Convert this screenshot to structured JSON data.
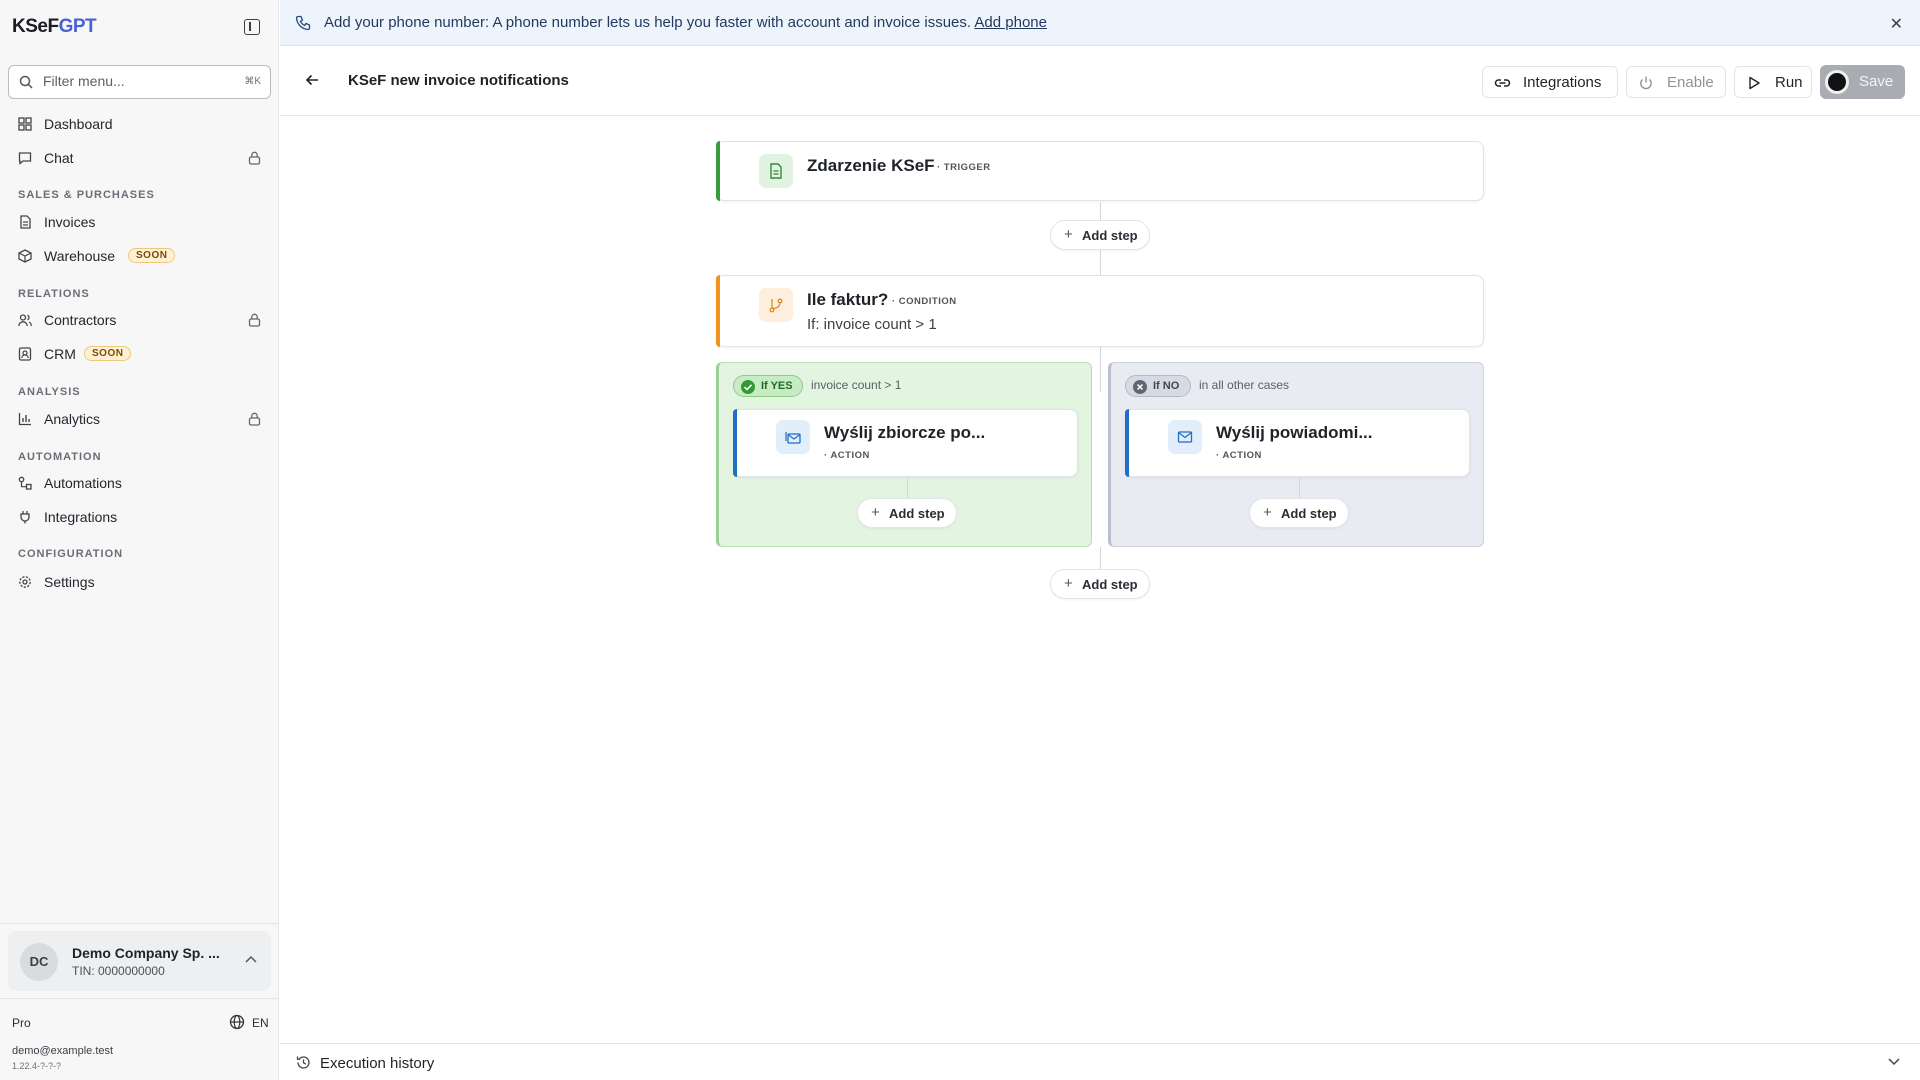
{
  "app": {
    "brand_main": "KSeF",
    "brand_accent": "GPT"
  },
  "sidebar": {
    "filter_placeholder": "Filter menu...",
    "filter_shortcut": "⌘K",
    "items": [
      {
        "label": "Dashboard"
      },
      {
        "label": "Chat"
      },
      {
        "label": "Invoices"
      },
      {
        "label": "Warehouse",
        "badge": "SOON"
      },
      {
        "label": "Contractors"
      },
      {
        "label": "CRM",
        "badge": "SOON"
      },
      {
        "label": "Analytics"
      },
      {
        "label": "Automations"
      },
      {
        "label": "Integrations"
      },
      {
        "label": "Settings"
      }
    ],
    "sections": [
      "SALES & PURCHASES",
      "RELATIONS",
      "ANALYSIS",
      "AUTOMATION",
      "CONFIGURATION"
    ],
    "company": {
      "initials": "DC",
      "name": "Demo Company Sp. ...",
      "tin": "TIN: 0000000000"
    },
    "plan": "Pro",
    "language": "EN",
    "email": "demo@example.test",
    "version": "1.22.4-?-?-?"
  },
  "banner": {
    "message": "Add your phone number: A phone number lets us help you faster with account and invoice issues.",
    "link": "Add phone"
  },
  "topbar": {
    "title": "KSeF new invoice notifications",
    "integrations_label": "Integrations",
    "enable_label": "Enable",
    "run_label": "Run",
    "save_label": "Save"
  },
  "flow": {
    "trigger": {
      "title": "Zdarzenie KSeF",
      "tag": "· TRIGGER"
    },
    "condition": {
      "title": "Ile faktur?",
      "tag": "· CONDITION",
      "subtitle": "If: invoice count > 1"
    },
    "yes_branch": {
      "pill": "If YES",
      "condition": "invoice count > 1",
      "action_title": "Wyślij zbiorcze po...",
      "action_tag": "· ACTION"
    },
    "no_branch": {
      "pill": "If NO",
      "condition": "in all other cases",
      "action_title": "Wyślij powiadomi...",
      "action_tag": "· ACTION"
    },
    "add_step_label": "Add step"
  },
  "footer": {
    "history_label": "Execution history"
  },
  "colors": {
    "trigger_accent": "#3a9a3e",
    "condition_accent": "#f0921c",
    "action_accent": "#1f6fc5",
    "yes_bg": "#e3f5e1",
    "no_bg": "#e8ebf2",
    "brand_accent": "#4b5fd6"
  }
}
